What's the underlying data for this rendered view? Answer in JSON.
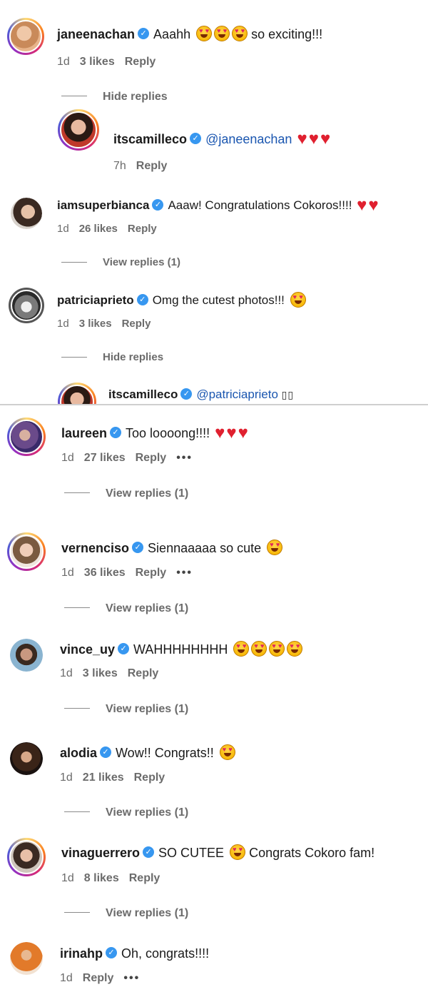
{
  "comments": [
    {
      "username": "janeenachan",
      "text": "Aaahh",
      "after": "so exciting!!!",
      "time": "1d",
      "likes": "3 likes",
      "reply": "Reply",
      "toggle": "Hide replies"
    },
    {
      "username": "itscamilleco",
      "mention": "@janeenachan",
      "time": "7h",
      "reply": "Reply"
    },
    {
      "username": "iamsuperbianca",
      "text": "Aaaw! Congratulations Cokoros!!!!",
      "time": "1d",
      "likes": "26 likes",
      "reply": "Reply",
      "toggle": "View replies (1)"
    },
    {
      "username": "patriciaprieto",
      "text": "Omg the cutest photos!!!",
      "time": "1d",
      "likes": "3 likes",
      "reply": "Reply",
      "toggle": "Hide replies"
    },
    {
      "username": "itscamilleco",
      "mention": "@patriciaprieto",
      "suffix": "▯▯"
    },
    {
      "username": "laureen",
      "text": "Too loooong!!!!",
      "time": "1d",
      "likes": "27 likes",
      "reply": "Reply",
      "more": "•••",
      "toggle": "View replies (1)"
    },
    {
      "username": "vernenciso",
      "text": "Siennaaaaa so cute",
      "time": "1d",
      "likes": "36 likes",
      "reply": "Reply",
      "more": "•••",
      "toggle": "View replies (1)"
    },
    {
      "username": "vince_uy",
      "text": "WAHHHHHHHH",
      "time": "1d",
      "likes": "3 likes",
      "reply": "Reply",
      "toggle": "View replies (1)"
    },
    {
      "username": "alodia",
      "text": "Wow!! Congrats!!",
      "time": "1d",
      "likes": "21 likes",
      "reply": "Reply",
      "toggle": "View replies (1)"
    },
    {
      "username": "vinaguerrero",
      "text": "SO CUTEE",
      "after": "Congrats Cokoro fam!",
      "time": "1d",
      "likes": "8 likes",
      "reply": "Reply",
      "toggle": "View replies (1)"
    },
    {
      "username": "irinahp",
      "text": "Oh, congrats!!!!",
      "time": "1d",
      "reply": "Reply",
      "more": "•••"
    }
  ],
  "icons": {
    "verified": "verified-badge-icon",
    "heart_eyes": "heart-eyes-emoji",
    "heart": "red-heart-emoji"
  },
  "colors": {
    "verified": "#3797f0",
    "mention": "#1a56b0",
    "heart": "#e0202f",
    "meta": "#6b6b6b"
  }
}
